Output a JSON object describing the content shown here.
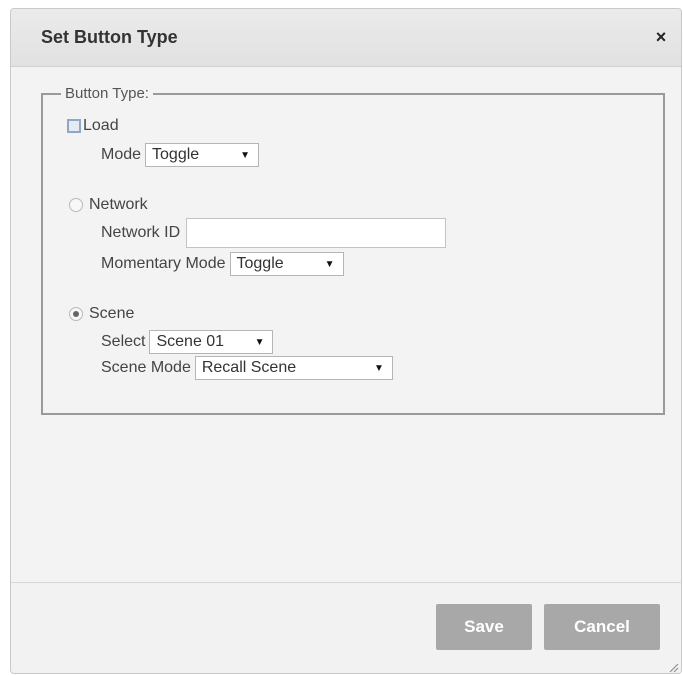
{
  "dialog": {
    "title": "Set Button Type",
    "close_glyph": "×"
  },
  "fieldset": {
    "legend": "Button Type:",
    "load": {
      "label": "Load",
      "mode_label": "Mode",
      "mode_value": "Toggle"
    },
    "network": {
      "label": "Network",
      "network_id_label": "Network ID",
      "network_id_value": "",
      "momentary_mode_label": "Momentary Mode",
      "momentary_mode_value": "Toggle"
    },
    "scene": {
      "label": "Scene",
      "select_label": "Select",
      "select_value": "Scene 01",
      "scene_mode_label": "Scene Mode",
      "scene_mode_value": "Recall Scene"
    }
  },
  "footer": {
    "save_label": "Save",
    "cancel_label": "Cancel"
  },
  "icons": {
    "dropdown": "chevron-down-icon",
    "close": "close-icon",
    "resize": "resize-grip-icon"
  }
}
